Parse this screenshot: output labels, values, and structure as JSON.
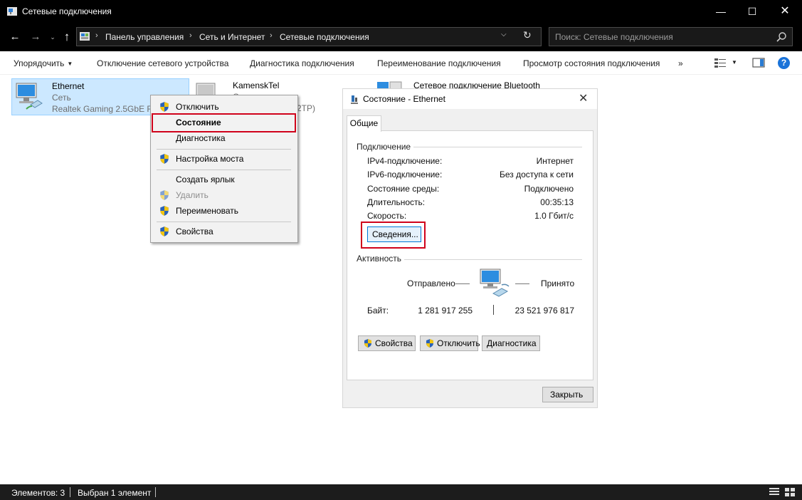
{
  "window": {
    "title": "Сетевые подключения",
    "controls": {
      "minimize": "—",
      "maximize": "☐",
      "close": "✕"
    }
  },
  "address": {
    "breadcrumb": [
      "Панель управления",
      "Сеть и Интернет",
      "Сетевые подключения"
    ],
    "separator": "›",
    "search_placeholder": "Поиск: Сетевые подключения"
  },
  "commands": {
    "organize": "Упорядочить",
    "disable_device": "Отключение сетевого устройства",
    "diagnose": "Диагностика подключения",
    "rename": "Переименование подключения",
    "view_status": "Просмотр состояния подключения",
    "more": "»",
    "help": "?"
  },
  "connections": [
    {
      "name": "Ethernet",
      "type": "Сеть",
      "adapter": "Realtek Gaming 2.5GbE Fa"
    },
    {
      "name": "KamenskTel",
      "type": "О",
      "adapter": "2TP)"
    },
    {
      "name": "Сетевое подключение Bluetooth"
    }
  ],
  "context_menu": {
    "items": [
      {
        "label": "Отключить",
        "shield": true
      },
      {
        "label": "Состояние",
        "bold": true
      },
      {
        "label": "Диагностика"
      },
      {
        "label": "Настройка моста",
        "shield": true
      },
      {
        "label": "Создать ярлык"
      },
      {
        "label": "Удалить",
        "shield": true,
        "disabled": true
      },
      {
        "label": "Переименовать",
        "shield": true
      },
      {
        "label": "Свойства",
        "shield": true
      }
    ]
  },
  "dialog": {
    "title": "Состояние - Ethernet",
    "close": "✕",
    "tab": "Общие",
    "connection_group": "Подключение",
    "rows": [
      {
        "label": "IPv4-подключение:",
        "value": "Интернет"
      },
      {
        "label": "IPv6-подключение:",
        "value": "Без доступа к сети"
      },
      {
        "label": "Состояние среды:",
        "value": "Подключено"
      },
      {
        "label": "Длительность:",
        "value": "00:35:13"
      },
      {
        "label": "Скорость:",
        "value": "1.0 Гбит/с"
      }
    ],
    "details_button": "Сведения...",
    "activity_group": "Активность",
    "sent_label": "Отправлено",
    "received_label": "Принято",
    "bytes_label": "Байт:",
    "bytes_sent": "1 281 917 255",
    "bytes_received": "23 521 976 817",
    "buttons": {
      "properties": "Свойства",
      "disable": "Отключить",
      "diagnose": "Диагностика"
    },
    "close_button": "Закрыть"
  },
  "statusbar": {
    "items_count": "Элементов: 3",
    "selected": "Выбран 1 элемент"
  },
  "colors": {
    "highlight_box": "#d0021b",
    "selection": "#cce8ff",
    "help_accent": "#1a73d9"
  }
}
